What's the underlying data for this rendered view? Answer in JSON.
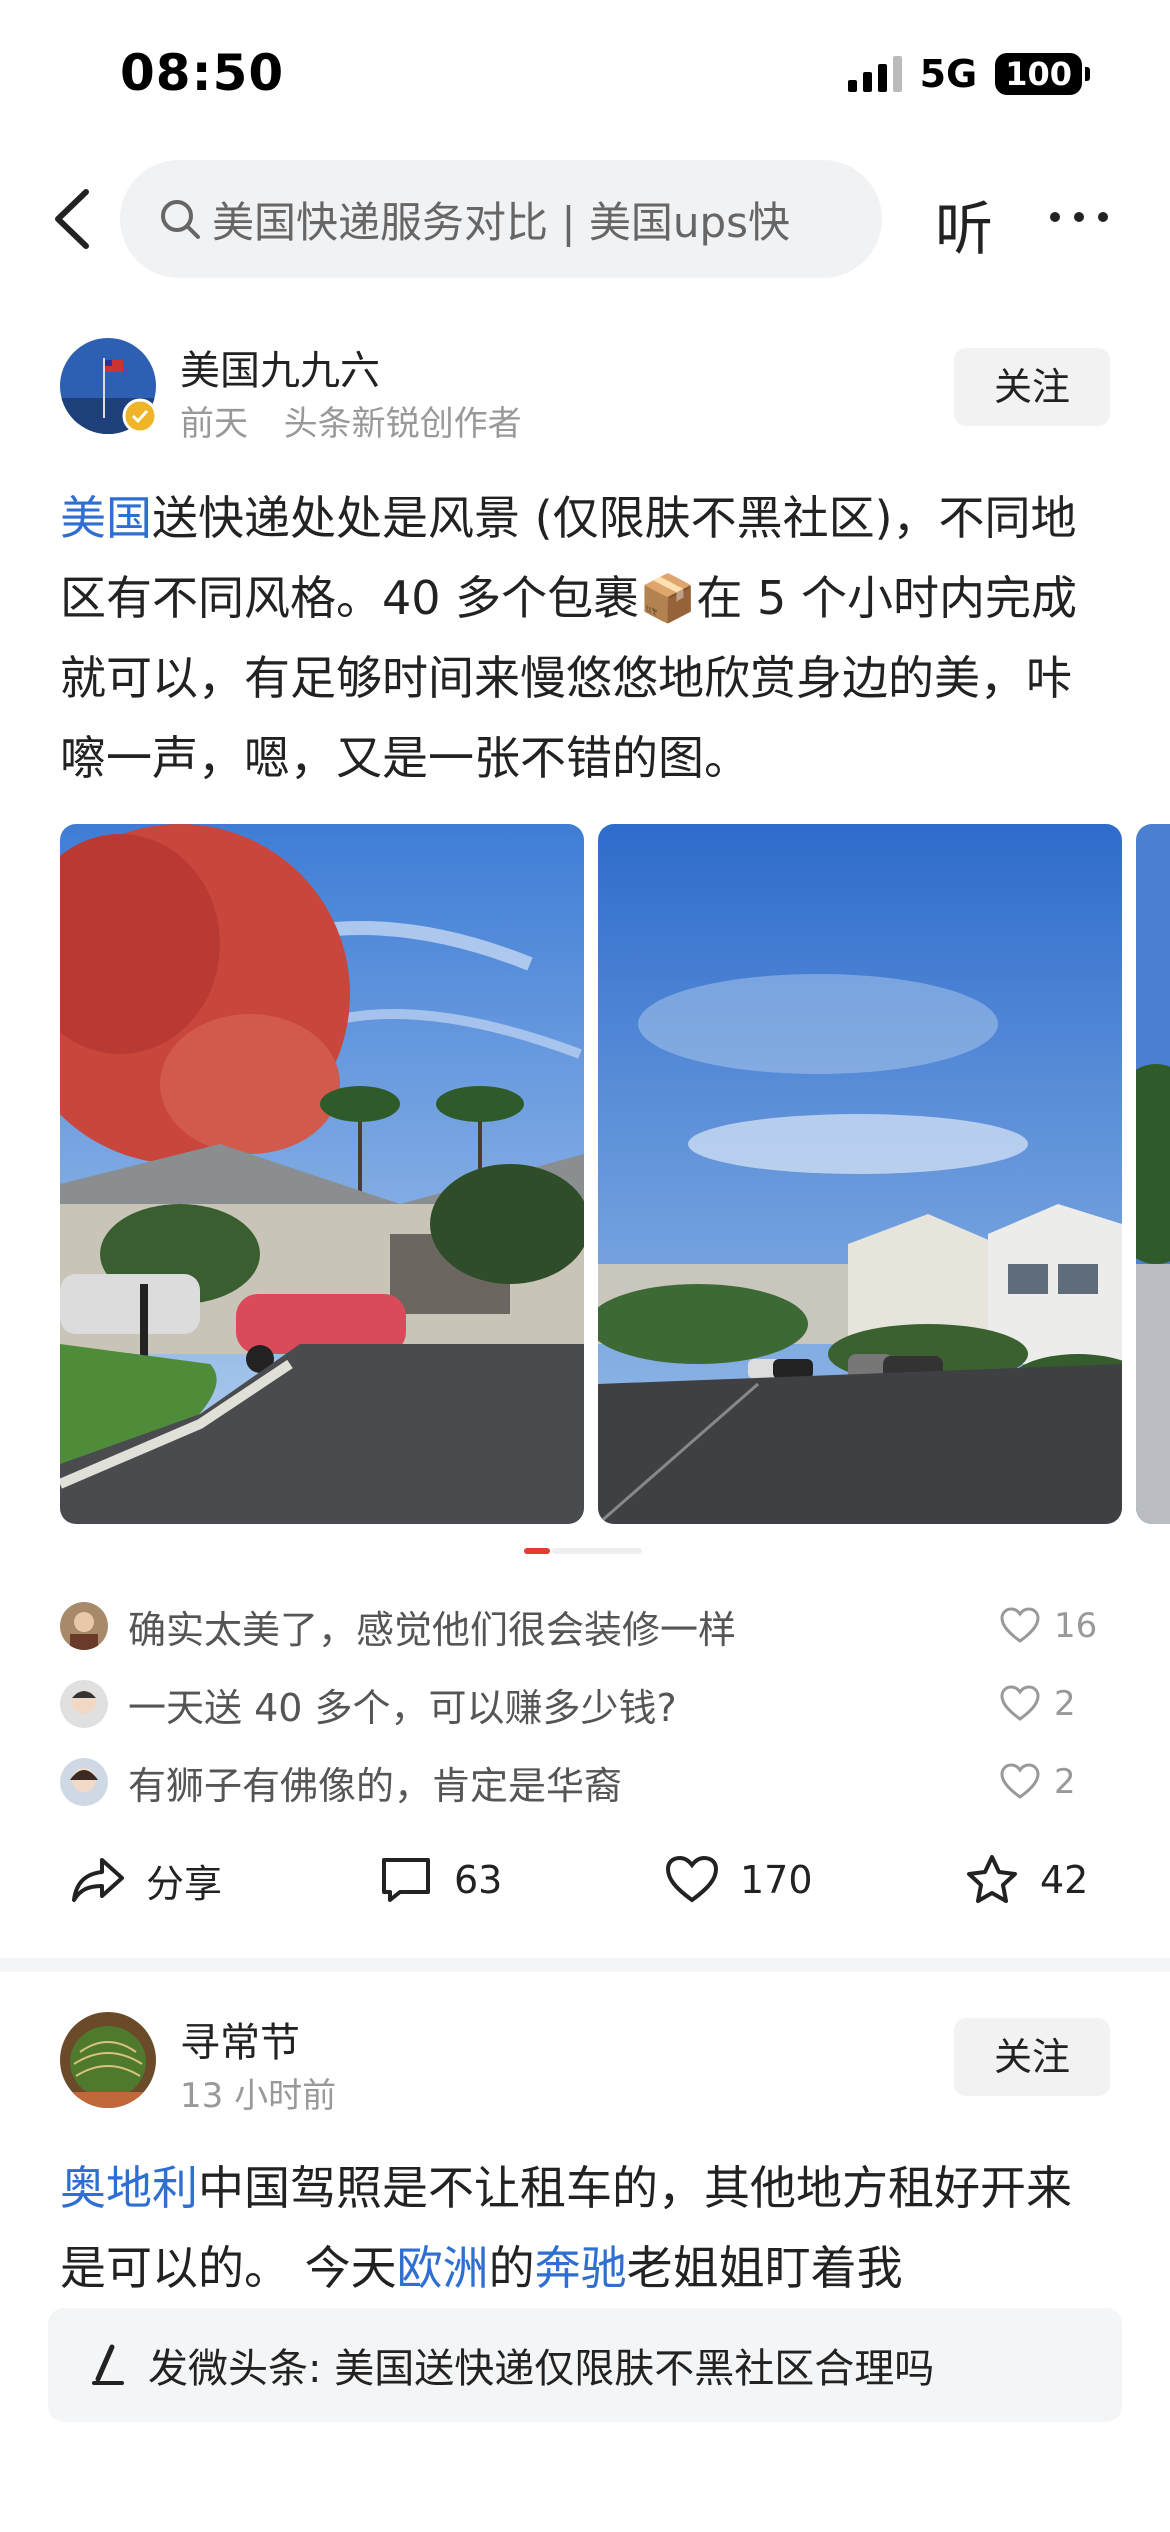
{
  "status_bar": {
    "time": "08:50",
    "network": "5G",
    "battery": "100"
  },
  "header": {
    "search_text": "美国快递服务对比 | 美国ups快",
    "listen_label": "听"
  },
  "post1": {
    "author": "美国九九六",
    "time": "前天",
    "badge": "头条新锐创作者",
    "follow_label": "关注",
    "text_link": "美国",
    "text_body": "送快递处处是风景 (仅限肤不黑社区)，不同地区有不同风格。40 多个包裹📦在 5 个小时内完成就可以，有足够时间来慢悠悠地欣赏身边的美，咔嚓一声，嗯，又是一张不错的图。",
    "comments": [
      {
        "text": "确实太美了，感觉他们很会装修一样",
        "likes": "16"
      },
      {
        "text": "一天送 40 多个，可以赚多少钱?",
        "likes": "2"
      },
      {
        "text": "有狮子有佛像的，肯定是华裔",
        "likes": "2"
      }
    ],
    "actions": {
      "share_label": "分享",
      "comment_count": "63",
      "like_count": "170",
      "favorite_count": "42"
    }
  },
  "post2": {
    "author": "寻常节",
    "time": "13 小时前",
    "follow_label": "关注",
    "link1": "奥地利",
    "seg1": "中国驾照是不让租车的，其他地方租好开来是可以的。 今天",
    "link2": "欧洲",
    "seg2": "的",
    "link3": "奔驰",
    "seg3": "老姐姐盯着我"
  },
  "composer": {
    "label": "发微头条: 美国送快递仅限肤不黑社区合理吗"
  },
  "colors": {
    "link": "#2f6fd1",
    "accent": "#e53b33"
  }
}
